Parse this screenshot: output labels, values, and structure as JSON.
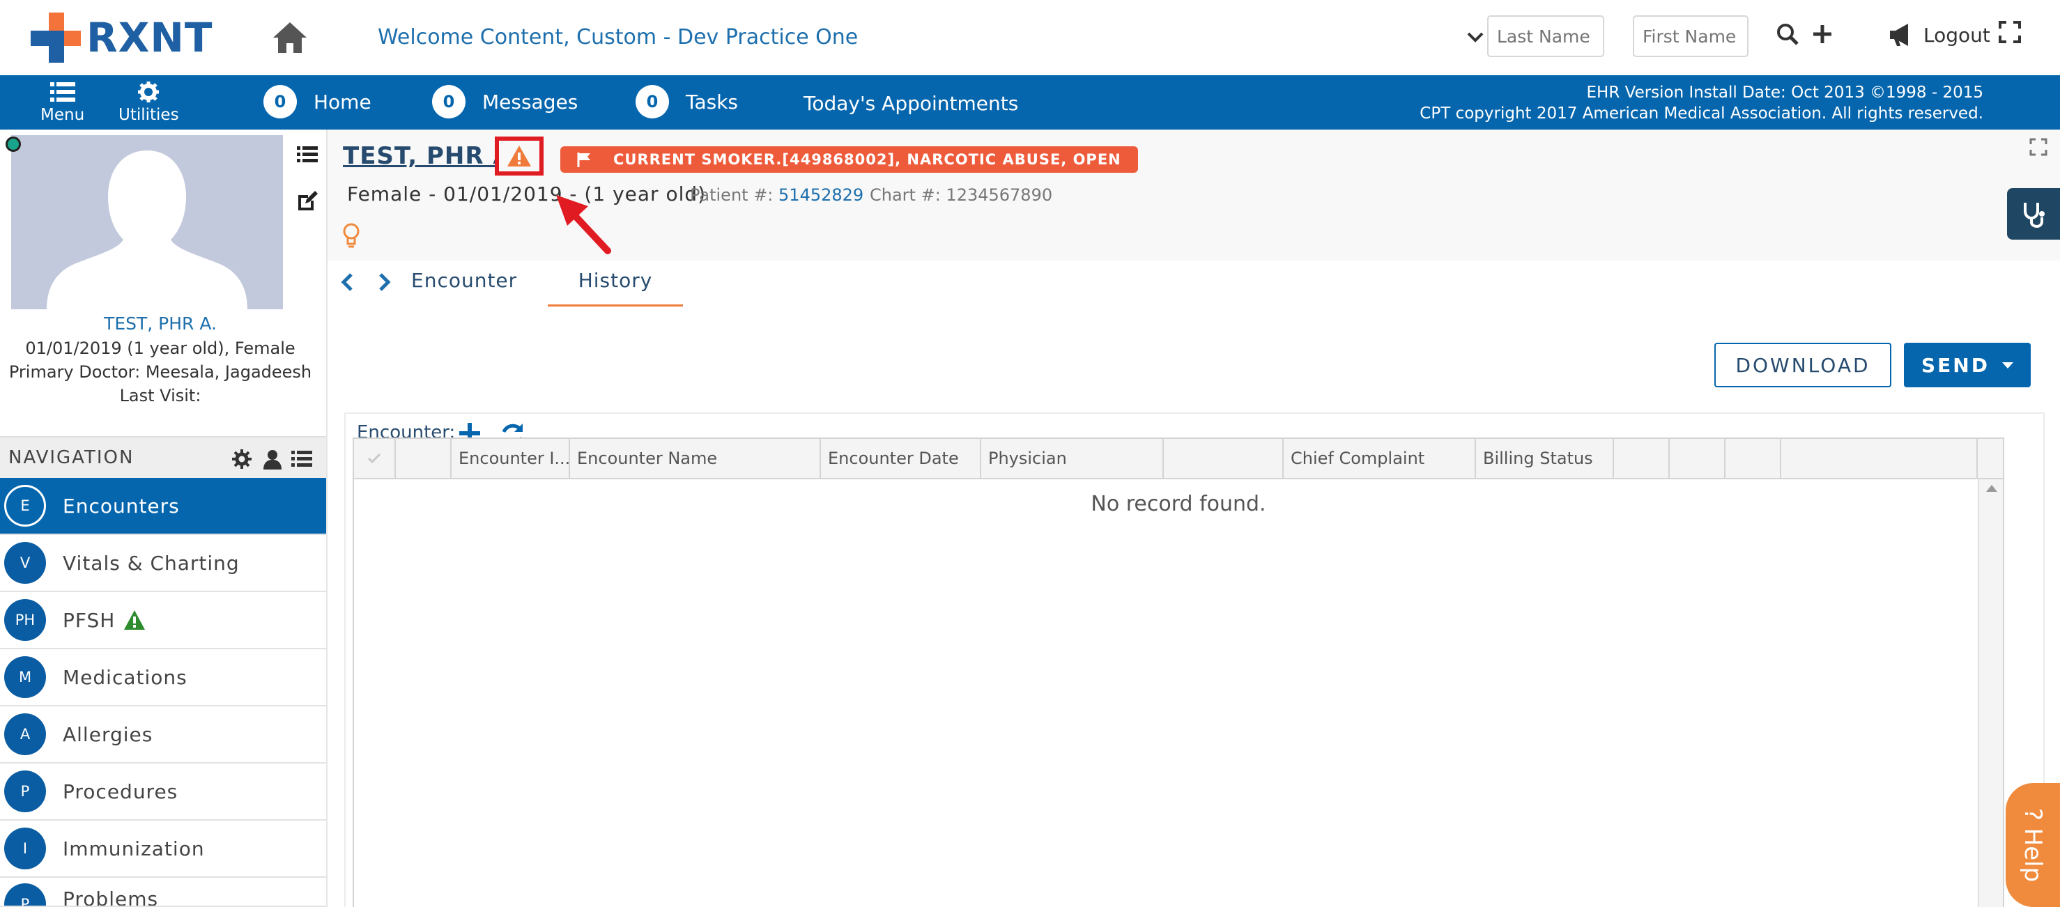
{
  "header": {
    "logo_text": "RXNT",
    "welcome": "Welcome  Content, Custom - Dev Practice One",
    "last_name_placeholder": "Last Name",
    "first_name_placeholder": "First Name",
    "logout_label": "Logout"
  },
  "navbar": {
    "menu_label": "Menu",
    "utilities_label": "Utilities",
    "links": [
      {
        "label": "Home",
        "count": "0"
      },
      {
        "label": "Messages",
        "count": "0"
      },
      {
        "label": "Tasks",
        "count": "0"
      }
    ],
    "appointments_label": "Today's Appointments",
    "copyright_line1": "EHR Version Install Date: Oct 2013 ©1998 - 2015",
    "copyright_line2": "CPT copyright 2017 American Medical Association. All rights reserved."
  },
  "sidebar": {
    "patient_name": "TEST, PHR A.",
    "dob_line": "01/01/2019 (1 year old), Female",
    "doctor_line": "Primary Doctor:  Meesala, Jagadeesh",
    "last_visit_line": "Last Visit:",
    "navigation_label": "NAVIGATION",
    "items": [
      {
        "badge": "E",
        "label": "Encounters",
        "active": true
      },
      {
        "badge": "V",
        "label": "Vitals & Charting"
      },
      {
        "badge": "PH",
        "label": "PFSH"
      },
      {
        "badge": "M",
        "label": "Medications"
      },
      {
        "badge": "A",
        "label": "Allergies"
      },
      {
        "badge": "P",
        "label": "Procedures"
      },
      {
        "badge": "I",
        "label": "Immunization"
      },
      {
        "badge": "P",
        "label": "Problems"
      }
    ]
  },
  "patient": {
    "name": "TEST, PHR A",
    "flag_text": "CURRENT SMOKER.[449868002], NARCOTIC ABUSE, OPEN",
    "demographics": "Female - 01/01/2019 - (1 year old)",
    "patient_number_label": "Patient #:",
    "patient_number": "51452829",
    "chart_number_label": "Chart #:",
    "chart_number": "1234567890"
  },
  "tabs": {
    "encounter": "Encounter",
    "history": "History"
  },
  "actions": {
    "download": "DOWNLOAD",
    "send": "SEND"
  },
  "grid": {
    "label": "Encounter:",
    "columns": [
      "",
      "",
      "Encounter I...",
      "Encounter Name",
      "Encounter Date",
      "Physician",
      "",
      "Chief Complaint",
      "Billing Status",
      "",
      "",
      "",
      ""
    ],
    "empty_message": "No record found."
  },
  "help": {
    "label": "? Help"
  },
  "colors": {
    "brand_blue": "#0566ae",
    "accent_orange": "#ee5b3b",
    "highlight_red": "#e11b22"
  }
}
